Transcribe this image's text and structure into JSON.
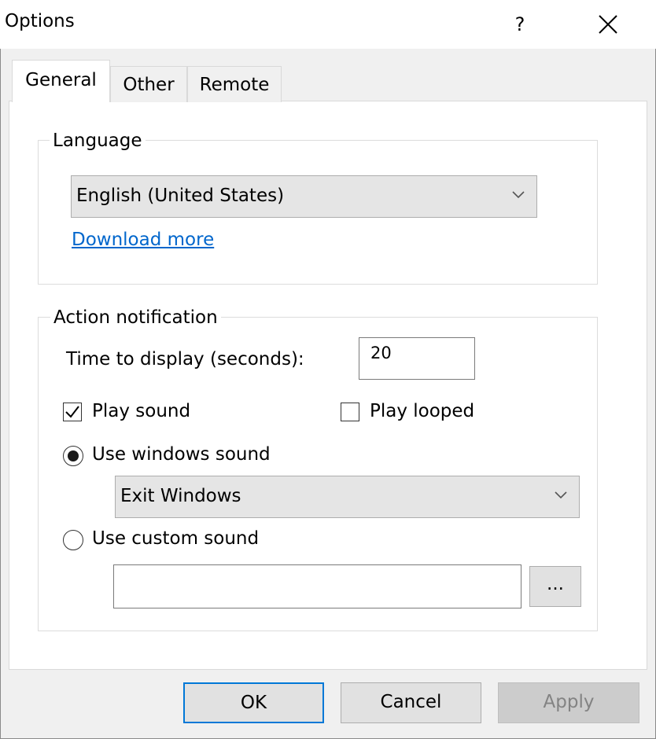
{
  "window": {
    "title": "Options",
    "help_label": "?",
    "close_icon": "close-icon"
  },
  "tabs": [
    {
      "label": "General",
      "active": true
    },
    {
      "label": "Other",
      "active": false
    },
    {
      "label": "Remote",
      "active": false
    }
  ],
  "language": {
    "legend": "Language",
    "selected": "English (United States)",
    "download_link": "Download more"
  },
  "notification": {
    "legend": "Action notification",
    "time_label": "Time to display (seconds):",
    "time_value": "20",
    "play_sound_label": "Play sound",
    "play_sound_checked": true,
    "play_looped_label": "Play looped",
    "play_looped_checked": false,
    "use_windows_sound_label": "Use windows sound",
    "use_windows_sound_selected": true,
    "windows_sound_value": "Exit Windows",
    "use_custom_sound_label": "Use custom sound",
    "use_custom_sound_selected": false,
    "custom_sound_path": "",
    "browse_label": "..."
  },
  "buttons": {
    "ok": "OK",
    "cancel": "Cancel",
    "apply": "Apply"
  },
  "colors": {
    "link": "#0066cc",
    "default_button_border": "#0078d7"
  }
}
